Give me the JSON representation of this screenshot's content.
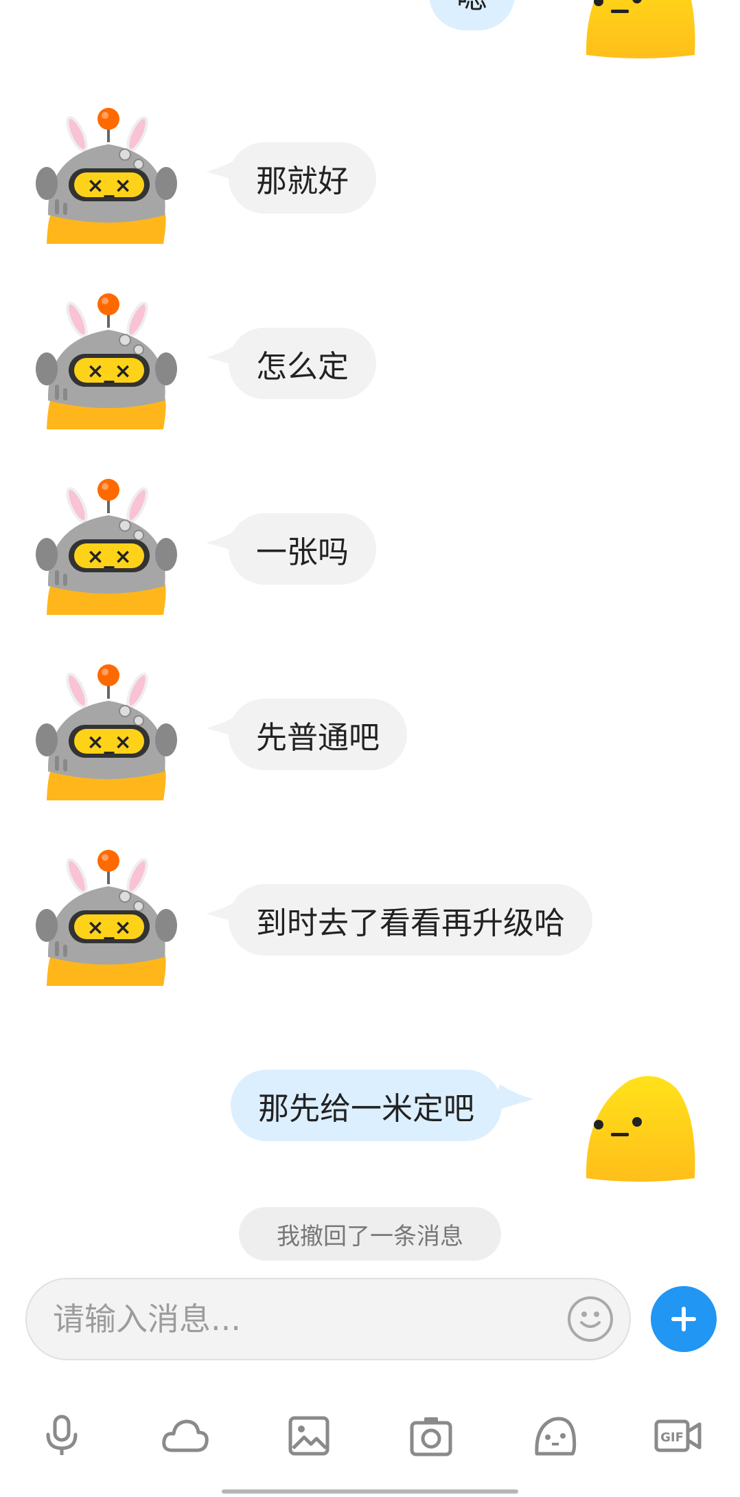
{
  "messages": [
    {
      "id": "m0",
      "side": "out",
      "text": "嗯"
    },
    {
      "id": "m1",
      "side": "in",
      "text": "那就好"
    },
    {
      "id": "m2",
      "side": "in",
      "text": "怎么定"
    },
    {
      "id": "m3",
      "side": "in",
      "text": "一张吗"
    },
    {
      "id": "m4",
      "side": "in",
      "text": "先普通吧"
    },
    {
      "id": "m5",
      "side": "in",
      "text": "到时去了看看再升级哈"
    },
    {
      "id": "m6",
      "side": "out",
      "text": "那先给一米定吧"
    }
  ],
  "system_note": "我撤回了一条消息",
  "composer": {
    "placeholder": "请输入消息...",
    "value": ""
  },
  "toolbar": {
    "icons": [
      "microphone-icon",
      "cloud-icon",
      "image-icon",
      "camera-icon",
      "sticker-icon",
      "gif-video-icon"
    ]
  },
  "colors": {
    "incoming_bubble": "#f2f2f2",
    "outgoing_bubble": "#dcefff",
    "accent": "#2196f3",
    "avatar_yellow": "#ffcc1a"
  }
}
